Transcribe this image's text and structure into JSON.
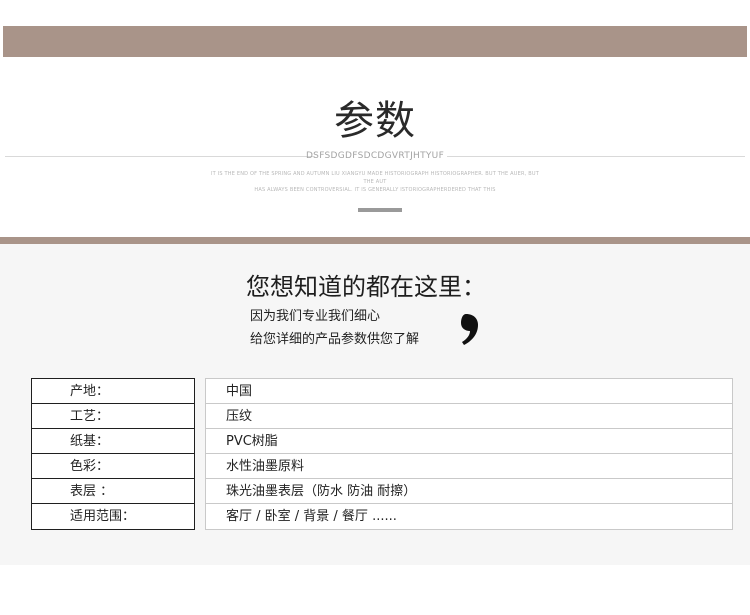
{
  "header": {
    "title": "参数",
    "subtitle": "DSFSDGDFSDCDGVRTJHTYUF",
    "fine_print_line1": "IT IS THE END OF THE SPRING AND AUTUMN LIU XIANGYU MADE HISTORIOGRAPH HISTORIOGRAPHER. BUT THE AUER, BUT THE AUT",
    "fine_print_line2": "HAS ALWAYS BEEN CONTROVERSIAL. IT IS GENERALLY ISTORIOGRAPHERDERED THAT THIS"
  },
  "intro": {
    "heading": "您想知道的都在这里：",
    "line1": "因为我们专业我们细心",
    "line2": "给您详细的产品参数供您了解"
  },
  "specs": [
    {
      "label": "产地：",
      "value": "中国"
    },
    {
      "label": "工艺：",
      "value": "压纹"
    },
    {
      "label": "纸基：",
      "value": "PVC树脂"
    },
    {
      "label": "色彩：",
      "value": "水性油墨原料"
    },
    {
      "label": "表层 ：",
      "value": "珠光油墨表层（防水  防油  耐擦）"
    },
    {
      "label": "适用范围：",
      "value": "客厅 / 卧室 / 背景 / 餐厅 ......"
    }
  ],
  "colors": {
    "band": "#a99489",
    "panel": "#f6f6f6",
    "accent_bar": "#9a9a9a"
  }
}
